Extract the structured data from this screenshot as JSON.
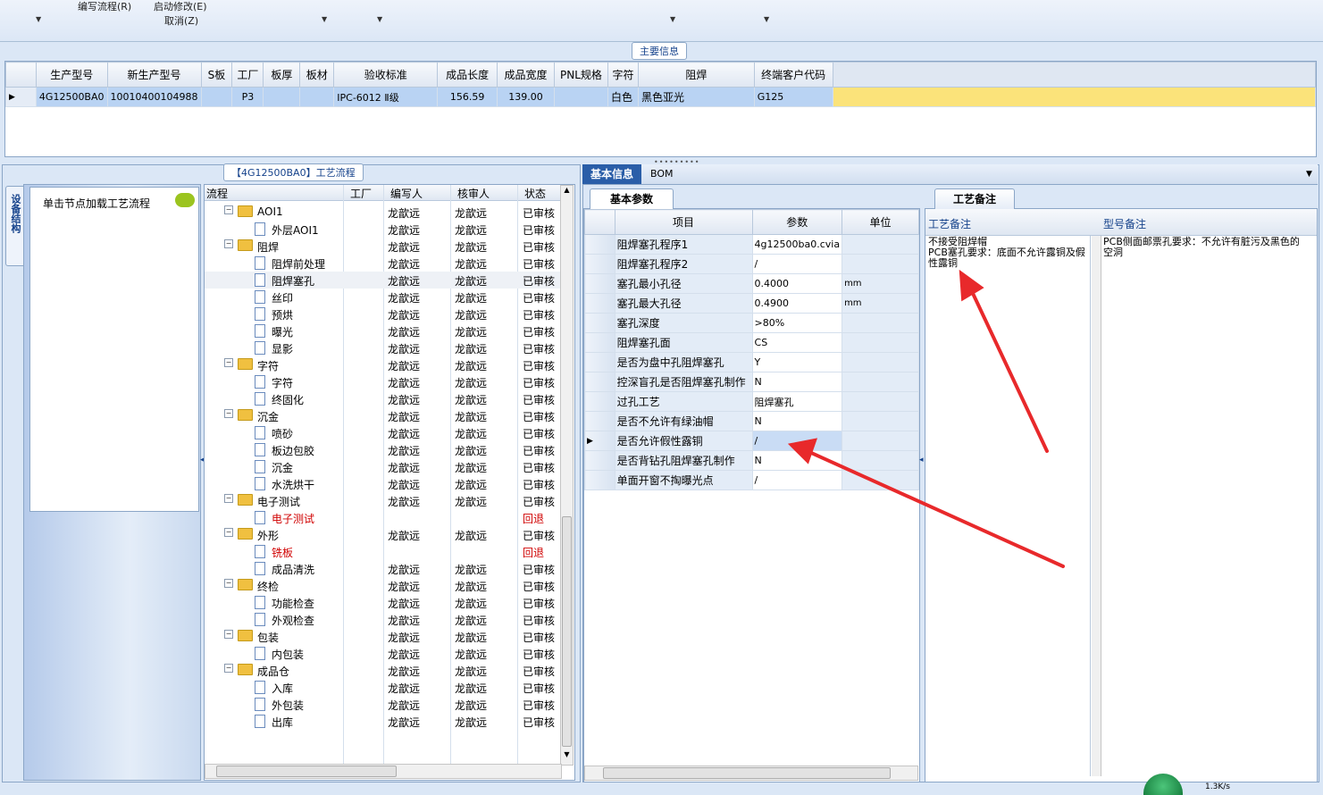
{
  "toolbar": {
    "item1": "编写流程(R)",
    "item2": "启动修改(E)",
    "item3": "取消(Z)"
  },
  "main_info": {
    "caption": "主要信息",
    "columns": [
      "生产型号",
      "新生产型号",
      "S板",
      "工厂",
      "板厚",
      "板材",
      "验收标准",
      "成品长度",
      "成品宽度",
      "PNL规格",
      "字符",
      "阻焊",
      "终端客户代码"
    ],
    "row": [
      "4G12500BA0",
      "10010400104988",
      "",
      "P3",
      "",
      "",
      "IPC-6012 Ⅱ级",
      "156.59",
      "139.00",
      "",
      "白色",
      "黑色亚光",
      "G125"
    ]
  },
  "left_panel": {
    "vertical_tab": "设备结构",
    "hint": "单击节点加载工艺流程"
  },
  "flow": {
    "caption": "【4G12500BA0】工艺流程",
    "columns": [
      "流程",
      "工厂",
      "编写人",
      "核审人",
      "状态"
    ],
    "rows": [
      {
        "level": 1,
        "type": "folder",
        "name": "AOI1",
        "writer": "龙歆远",
        "reviewer": "龙歆远",
        "status": "已审核",
        "red": false
      },
      {
        "level": 2,
        "type": "doc",
        "name": "外层AOI1",
        "writer": "龙歆远",
        "reviewer": "龙歆远",
        "status": "已审核",
        "red": false
      },
      {
        "level": 1,
        "type": "folder",
        "name": "阻焊",
        "writer": "龙歆远",
        "reviewer": "龙歆远",
        "status": "已审核",
        "red": false
      },
      {
        "level": 2,
        "type": "doc",
        "name": "阻焊前处理",
        "writer": "龙歆远",
        "reviewer": "龙歆远",
        "status": "已审核",
        "red": false
      },
      {
        "level": 2,
        "type": "doc",
        "name": "阻焊塞孔",
        "writer": "龙歆远",
        "reviewer": "龙歆远",
        "status": "已审核",
        "red": false
      },
      {
        "level": 2,
        "type": "doc",
        "name": "丝印",
        "writer": "龙歆远",
        "reviewer": "龙歆远",
        "status": "已审核",
        "red": false
      },
      {
        "level": 2,
        "type": "doc",
        "name": "预烘",
        "writer": "龙歆远",
        "reviewer": "龙歆远",
        "status": "已审核",
        "red": false
      },
      {
        "level": 2,
        "type": "doc",
        "name": "曝光",
        "writer": "龙歆远",
        "reviewer": "龙歆远",
        "status": "已审核",
        "red": false
      },
      {
        "level": 2,
        "type": "doc",
        "name": "显影",
        "writer": "龙歆远",
        "reviewer": "龙歆远",
        "status": "已审核",
        "red": false
      },
      {
        "level": 1,
        "type": "folder",
        "name": "字符",
        "writer": "龙歆远",
        "reviewer": "龙歆远",
        "status": "已审核",
        "red": false
      },
      {
        "level": 2,
        "type": "doc",
        "name": "字符",
        "writer": "龙歆远",
        "reviewer": "龙歆远",
        "status": "已审核",
        "red": false
      },
      {
        "level": 2,
        "type": "doc",
        "name": "终固化",
        "writer": "龙歆远",
        "reviewer": "龙歆远",
        "status": "已审核",
        "red": false
      },
      {
        "level": 1,
        "type": "folder",
        "name": "沉金",
        "writer": "龙歆远",
        "reviewer": "龙歆远",
        "status": "已审核",
        "red": false
      },
      {
        "level": 2,
        "type": "doc",
        "name": "喷砂",
        "writer": "龙歆远",
        "reviewer": "龙歆远",
        "status": "已审核",
        "red": false
      },
      {
        "level": 2,
        "type": "doc",
        "name": "板边包胶",
        "writer": "龙歆远",
        "reviewer": "龙歆远",
        "status": "已审核",
        "red": false
      },
      {
        "level": 2,
        "type": "doc",
        "name": "沉金",
        "writer": "龙歆远",
        "reviewer": "龙歆远",
        "status": "已审核",
        "red": false
      },
      {
        "level": 2,
        "type": "doc",
        "name": "水洗烘干",
        "writer": "龙歆远",
        "reviewer": "龙歆远",
        "status": "已审核",
        "red": false
      },
      {
        "level": 1,
        "type": "folder",
        "name": "电子测试",
        "writer": "龙歆远",
        "reviewer": "龙歆远",
        "status": "已审核",
        "red": false
      },
      {
        "level": 2,
        "type": "doc",
        "name": "电子测试",
        "writer": "",
        "reviewer": "",
        "status": "回退",
        "red": true
      },
      {
        "level": 1,
        "type": "folder",
        "name": "外形",
        "writer": "龙歆远",
        "reviewer": "龙歆远",
        "status": "已审核",
        "red": false
      },
      {
        "level": 2,
        "type": "doc",
        "name": "铣板",
        "writer": "",
        "reviewer": "",
        "status": "回退",
        "red": true
      },
      {
        "level": 2,
        "type": "doc",
        "name": "成品清洗",
        "writer": "龙歆远",
        "reviewer": "龙歆远",
        "status": "已审核",
        "red": false
      },
      {
        "level": 1,
        "type": "folder",
        "name": "终检",
        "writer": "龙歆远",
        "reviewer": "龙歆远",
        "status": "已审核",
        "red": false
      },
      {
        "level": 2,
        "type": "doc",
        "name": "功能检查",
        "writer": "龙歆远",
        "reviewer": "龙歆远",
        "status": "已审核",
        "red": false
      },
      {
        "level": 2,
        "type": "doc",
        "name": "外观检查",
        "writer": "龙歆远",
        "reviewer": "龙歆远",
        "status": "已审核",
        "red": false
      },
      {
        "level": 1,
        "type": "folder",
        "name": "包装",
        "writer": "龙歆远",
        "reviewer": "龙歆远",
        "status": "已审核",
        "red": false
      },
      {
        "level": 2,
        "type": "doc",
        "name": "内包装",
        "writer": "龙歆远",
        "reviewer": "龙歆远",
        "status": "已审核",
        "red": false
      },
      {
        "level": 1,
        "type": "folder",
        "name": "成品仓",
        "writer": "龙歆远",
        "reviewer": "龙歆远",
        "status": "已审核",
        "red": false
      },
      {
        "level": 2,
        "type": "doc",
        "name": "入库",
        "writer": "龙歆远",
        "reviewer": "龙歆远",
        "status": "已审核",
        "red": false
      },
      {
        "level": 2,
        "type": "doc",
        "name": "外包装",
        "writer": "龙歆远",
        "reviewer": "龙歆远",
        "status": "已审核",
        "red": false
      },
      {
        "level": 2,
        "type": "doc",
        "name": "出库",
        "writer": "龙歆远",
        "reviewer": "龙歆远",
        "status": "已审核",
        "red": false
      }
    ]
  },
  "detail": {
    "tabs": [
      "基本信息",
      "BOM"
    ],
    "subtab": "基本参数",
    "columns": [
      "项目",
      "参数",
      "单位"
    ],
    "params": [
      {
        "item": "阻焊塞孔程序1",
        "value": "4g12500ba0.cvia",
        "unit": ""
      },
      {
        "item": "阻焊塞孔程序2",
        "value": "/",
        "unit": ""
      },
      {
        "item": "塞孔最小孔径",
        "value": "0.4000",
        "unit": "mm"
      },
      {
        "item": "塞孔最大孔径",
        "value": "0.4900",
        "unit": "mm"
      },
      {
        "item": "塞孔深度",
        "value": ">80%",
        "unit": ""
      },
      {
        "item": "阻焊塞孔面",
        "value": "CS",
        "unit": ""
      },
      {
        "item": "是否为盘中孔阻焊塞孔",
        "value": "Y",
        "unit": ""
      },
      {
        "item": "控深盲孔是否阻焊塞孔制作",
        "value": "N",
        "unit": ""
      },
      {
        "item": "过孔工艺",
        "value": "阻焊塞孔",
        "unit": ""
      },
      {
        "item": "是否不允许有绿油帽",
        "value": "N",
        "unit": ""
      },
      {
        "item": "是否允许假性露铜",
        "value": "/",
        "unit": ""
      },
      {
        "item": "是否背钻孔阻焊塞孔制作",
        "value": "N",
        "unit": ""
      },
      {
        "item": "单面开窗不掏曝光点",
        "value": "/",
        "unit": ""
      }
    ]
  },
  "remarks": {
    "tab": "工艺备注",
    "col1": "工艺备注",
    "col2": "型号备注",
    "text1": "不接受阻焊帽\nPCB塞孔要求：底面不允许露铜及假性露铜",
    "text2": "PCB侧面邮票孔要求：不允许有脏污及黑色的空洞"
  },
  "status": {
    "net_speed": "1.3K/s"
  },
  "colors": {
    "annotation": "#e8292b",
    "accent": "#2a5ea8",
    "selected": "#b9d3f3",
    "highlight": "#fbe37a"
  }
}
